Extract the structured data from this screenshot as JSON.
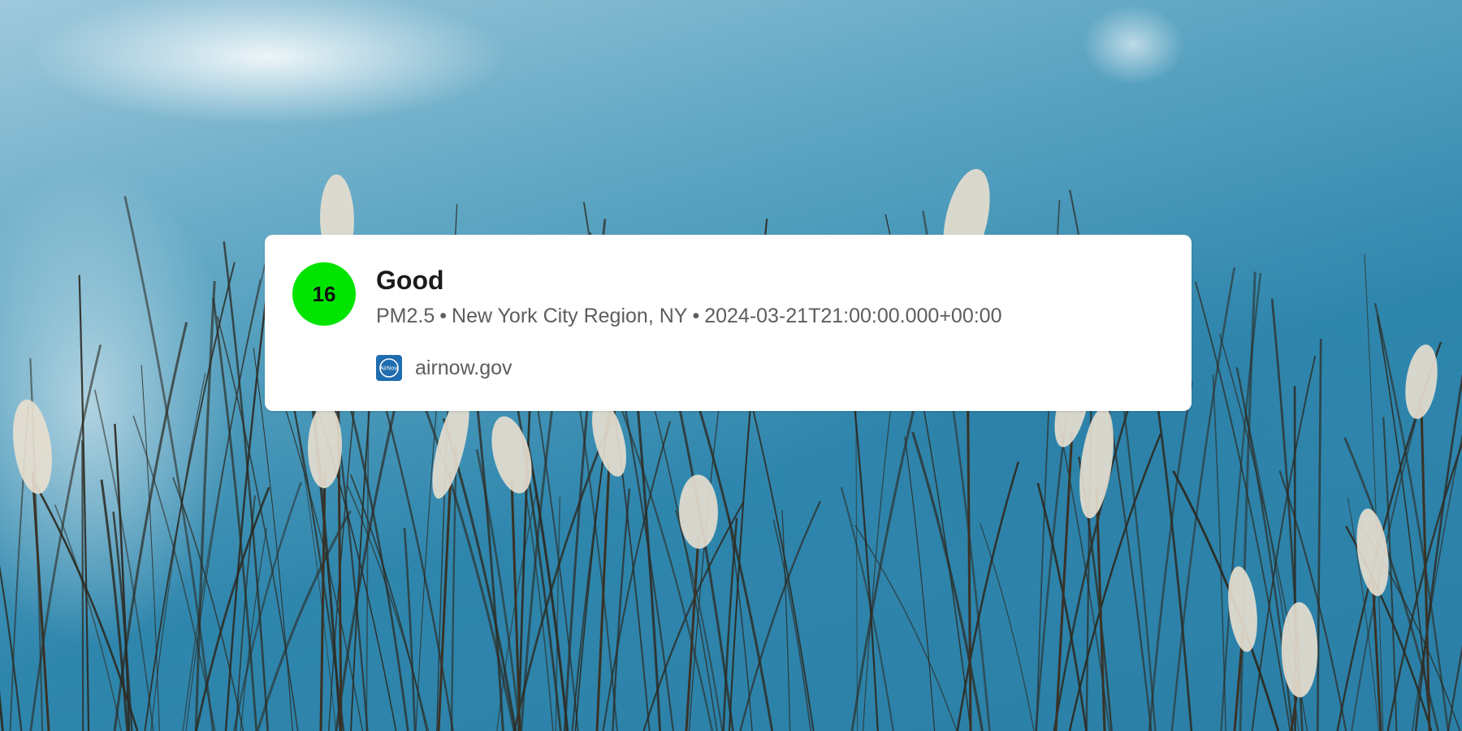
{
  "background": {
    "sky_color_top": "#9fc9dc",
    "sky_color_bottom": "#2b7fa6",
    "grass_color": "#2c2a22",
    "plume_color": "#e9dfcf"
  },
  "reading": {
    "aqi_value": "16",
    "aqi_color": "#00e400",
    "category": "Good",
    "pollutant": "PM2.5",
    "separator": "•",
    "region": "New York City Region, NY",
    "timestamp": "2024-03-21T21:00:00.000+00:00"
  },
  "source": {
    "logo_icon": "airnow-logo-icon",
    "logo_text": "AirNow",
    "domain": "airnow.gov"
  }
}
